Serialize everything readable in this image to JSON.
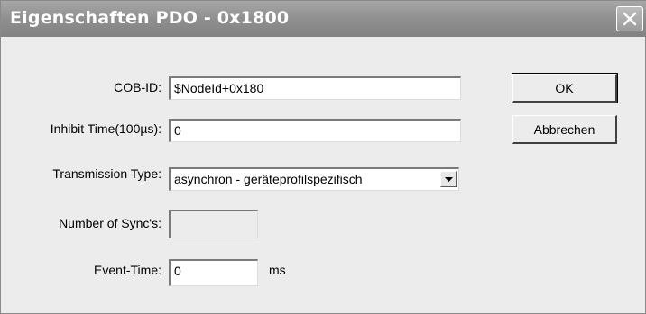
{
  "window": {
    "title": "Eigenschaften PDO - 0x1800"
  },
  "form": {
    "cob_id": {
      "label": "COB-ID:",
      "value": "$NodeId+0x180"
    },
    "inhibit_time": {
      "label": "Inhibit Time(100µs):",
      "value": "0"
    },
    "transmission_type": {
      "label": "Transmission Type:",
      "selected": "asynchron - geräteprofilspezifisch"
    },
    "number_of_syncs": {
      "label": "Number of Sync's:",
      "value": ""
    },
    "event_time": {
      "label": "Event-Time:",
      "value": "0",
      "unit": "ms"
    }
  },
  "buttons": {
    "ok": "OK",
    "cancel": "Abbrechen"
  },
  "icons": {
    "close": "close-icon",
    "dropdown": "chevron-down-icon"
  }
}
